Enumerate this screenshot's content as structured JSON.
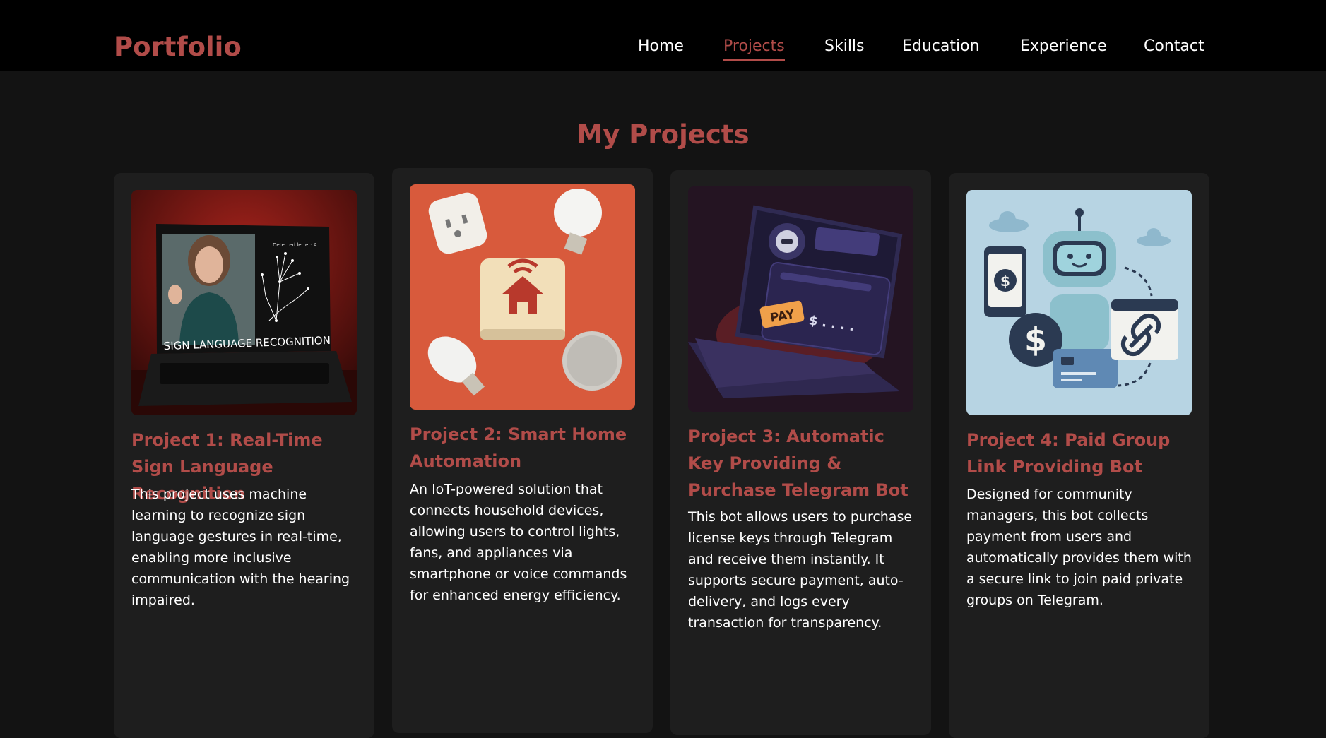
{
  "nav": {
    "brand": "Portfolio",
    "links": [
      {
        "label": "Home",
        "active": false
      },
      {
        "label": "Projects",
        "active": true
      },
      {
        "label": "Skills",
        "active": false
      },
      {
        "label": "Education",
        "active": false
      },
      {
        "label": "Experience",
        "active": false
      },
      {
        "label": "Contact",
        "active": false
      }
    ]
  },
  "section": {
    "title": "My Projects"
  },
  "projects": [
    {
      "title": "Project 1: Real-Time Sign Language Recognition",
      "description": "This project uses machine learning to recognize sign language gestures in real-time, enabling more inclusive communication with the hearing impaired.",
      "image_caption": "SIGN LANGUAGE RECOGNITION",
      "image_subcaption": "Detected letter: A"
    },
    {
      "title": "Project 2: Smart Home Automation",
      "description": "An IoT-powered solution that connects household devices, allowing users to control lights, fans, and appliances via smartphone or voice commands for enhanced energy efficiency."
    },
    {
      "title": "Project 3: Automatic Key Providing & Purchase Telegram Bot",
      "description": "This bot allows users to purchase license keys through Telegram and receive them instantly. It supports secure payment, auto-delivery, and logs every transaction for transparency.",
      "image_pay_label": "PAY",
      "image_price_label": "$ . . . ."
    },
    {
      "title": "Project 4: Paid Group Link Providing Bot",
      "description": "Designed for community managers, this bot collects payment from users and automatically provides them with a secure link to join paid private groups on Telegram.",
      "image_dollar": "$"
    }
  ],
  "colors": {
    "accent": "#b14c49",
    "navbar_bg": "#000000",
    "page_bg": "#131313",
    "card_bg": "#1e1e1e",
    "text": "#ffffff"
  }
}
